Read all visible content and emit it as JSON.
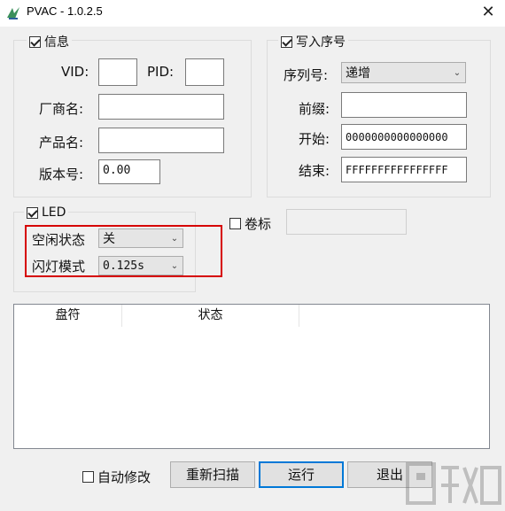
{
  "window": {
    "title": "PVAC - 1.0.2.5",
    "close_glyph": "✕"
  },
  "info_group": {
    "legend": "信息",
    "checked": true,
    "vid_label": "VID:",
    "vid_value": "",
    "pid_label": "PID:",
    "pid_value": "",
    "vendor_label": "厂商名:",
    "vendor_value": "",
    "product_label": "产品名:",
    "product_value": "",
    "version_label": "版本号:",
    "version_value": "0.00"
  },
  "serial_group": {
    "legend": "写入序号",
    "checked": true,
    "serial_label": "序列号:",
    "serial_mode": "递增",
    "prefix_label": "前缀:",
    "prefix_value": "",
    "start_label": "开始:",
    "start_value": "0000000000000000",
    "end_label": "结束:",
    "end_value": "FFFFFFFFFFFFFFFF"
  },
  "led_group": {
    "legend": "LED",
    "checked": true,
    "idle_label": "空闲状态",
    "idle_value": "关",
    "blink_label": "闪灯模式",
    "blink_value": "0.125s"
  },
  "volume_label": {
    "label": "卷标",
    "checked": false,
    "value": ""
  },
  "drive_list": {
    "columns": [
      "盘符",
      "状态"
    ]
  },
  "footer": {
    "auto_modify_label": "自动修改",
    "auto_modify_checked": false,
    "rescan_label": "重新扫描",
    "run_label": "运行",
    "exit_label": "退出"
  },
  "colors": {
    "highlight_box": "#d60000",
    "default_button_border": "#0078d7",
    "window_bg": "#f0f0f0"
  }
}
